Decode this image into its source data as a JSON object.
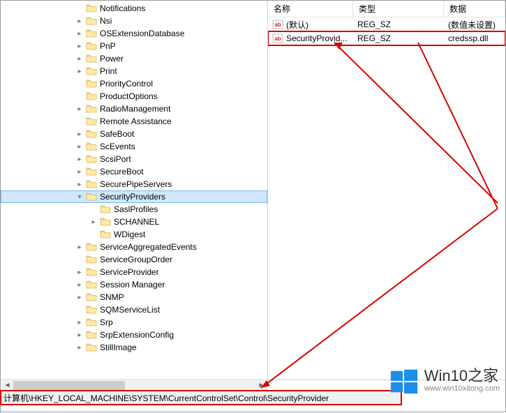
{
  "tree": {
    "items": [
      {
        "label": "Notifications",
        "indent": 106,
        "exp": "none"
      },
      {
        "label": "Nsi",
        "indent": 106,
        "exp": "closed"
      },
      {
        "label": "OSExtensionDatabase",
        "indent": 106,
        "exp": "closed"
      },
      {
        "label": "PnP",
        "indent": 106,
        "exp": "closed"
      },
      {
        "label": "Power",
        "indent": 106,
        "exp": "closed"
      },
      {
        "label": "Print",
        "indent": 106,
        "exp": "closed"
      },
      {
        "label": "PriorityControl",
        "indent": 106,
        "exp": "none"
      },
      {
        "label": "ProductOptions",
        "indent": 106,
        "exp": "none"
      },
      {
        "label": "RadioManagement",
        "indent": 106,
        "exp": "closed"
      },
      {
        "label": "Remote Assistance",
        "indent": 106,
        "exp": "none"
      },
      {
        "label": "SafeBoot",
        "indent": 106,
        "exp": "closed"
      },
      {
        "label": "ScEvents",
        "indent": 106,
        "exp": "closed"
      },
      {
        "label": "ScsiPort",
        "indent": 106,
        "exp": "closed"
      },
      {
        "label": "SecureBoot",
        "indent": 106,
        "exp": "closed"
      },
      {
        "label": "SecurePipeServers",
        "indent": 106,
        "exp": "closed"
      },
      {
        "label": "SecurityProviders",
        "indent": 106,
        "exp": "open",
        "selected": true
      },
      {
        "label": "SaslProfiles",
        "indent": 126,
        "exp": "none"
      },
      {
        "label": "SCHANNEL",
        "indent": 126,
        "exp": "closed"
      },
      {
        "label": "WDigest",
        "indent": 126,
        "exp": "none"
      },
      {
        "label": "ServiceAggregatedEvents",
        "indent": 106,
        "exp": "closed"
      },
      {
        "label": "ServiceGroupOrder",
        "indent": 106,
        "exp": "none"
      },
      {
        "label": "ServiceProvider",
        "indent": 106,
        "exp": "closed"
      },
      {
        "label": "Session Manager",
        "indent": 106,
        "exp": "closed"
      },
      {
        "label": "SNMP",
        "indent": 106,
        "exp": "closed"
      },
      {
        "label": "SQMServiceList",
        "indent": 106,
        "exp": "none"
      },
      {
        "label": "Srp",
        "indent": 106,
        "exp": "closed"
      },
      {
        "label": "SrpExtensionConfig",
        "indent": 106,
        "exp": "closed"
      },
      {
        "label": "StillImage",
        "indent": 106,
        "exp": "closed"
      }
    ]
  },
  "list": {
    "header": {
      "name": "名称",
      "type": "类型",
      "data": "数据"
    },
    "rows": [
      {
        "name": "(默认)",
        "type": "REG_SZ",
        "data": "(数值未设置)",
        "highlight": false
      },
      {
        "name": "SecurityProvid...",
        "type": "REG_SZ",
        "data": "credssp.dll",
        "highlight": true
      }
    ]
  },
  "status_bar": {
    "path": "计算机\\HKEY_LOCAL_MACHINE\\SYSTEM\\CurrentControlSet\\Control\\SecurityProvider"
  },
  "watermark": {
    "title": "Win10之家",
    "url": "www.win10xitong.com"
  },
  "colors": {
    "highlight": "#d60000"
  }
}
